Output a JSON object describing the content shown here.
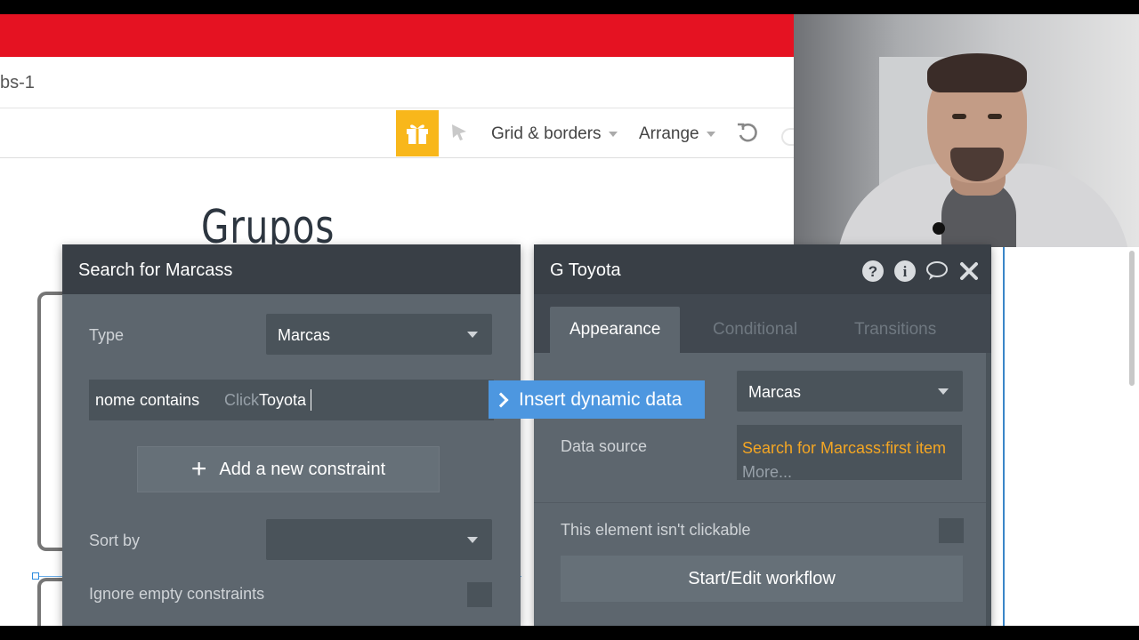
{
  "browser": {
    "tab_name": "bs-1"
  },
  "toolbar": {
    "gift_icon": "gift-icon",
    "grid_borders_label": "Grid & borders",
    "arrange_label": "Arrange"
  },
  "canvas": {
    "heading_text": "Grupos"
  },
  "search_panel": {
    "title": "Search for Marcass",
    "type_label": "Type",
    "type_value": "Marcas",
    "constraint_field": "nome contains",
    "constraint_placeholder": "Click",
    "constraint_value": "Toyota",
    "insert_dynamic_label": "Insert dynamic data",
    "add_constraint_label": "Add a new constraint",
    "sort_by_label": "Sort by",
    "sort_by_value": "",
    "ignore_empty_label": "Ignore empty constraints"
  },
  "element_panel": {
    "title": "G Toyota",
    "tabs": [
      {
        "label": "Appearance"
      },
      {
        "label": "Conditional"
      },
      {
        "label": "Transitions"
      }
    ],
    "type_value": "Marcas",
    "data_source_label": "Data source",
    "data_source_value": "Search for Marcass:first item",
    "data_source_more": "More...",
    "clickable_label": "This element isn't clickable",
    "workflow_button": "Start/Edit workflow"
  },
  "colors": {
    "brand_red": "#e51222",
    "panel_bg": "#5d666e",
    "panel_header": "#393f46",
    "accent_blue": "#4d97e0",
    "dynamic_orange": "#f4a623",
    "gift_yellow": "#f8b71b"
  }
}
